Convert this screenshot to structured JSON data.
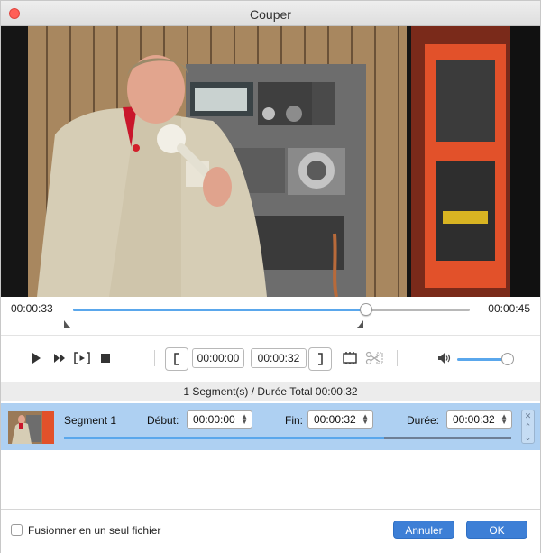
{
  "window": {
    "title": "Couper"
  },
  "timeline": {
    "current_time": "00:00:33",
    "total_time": "00:00:45",
    "progress_fraction": 0.738
  },
  "controls": {
    "start_time": "00:00:00",
    "end_time": "00:00:32",
    "volume_fraction": 0.9,
    "icons": [
      "play-icon",
      "fast-forward-icon",
      "play-selection-icon",
      "stop-icon",
      "set-start-bracket-icon",
      "set-end-bracket-icon",
      "add-segment-icon",
      "split-icon",
      "volume-icon"
    ]
  },
  "summary": {
    "text": "1 Segment(s) / Durée Total 00:00:32"
  },
  "segments": [
    {
      "name": "Segment 1",
      "start_label": "Début:",
      "start_value": "00:00:00",
      "end_label": "Fin:",
      "end_value": "00:00:32",
      "duration_label": "Durée:",
      "duration_value": "00:00:32",
      "progress_fraction": 0.715
    }
  ],
  "footer": {
    "merge_label": "Fusionner en un seul fichier",
    "merge_checked": false,
    "cancel_label": "Annuler",
    "ok_label": "OK"
  },
  "colors": {
    "accent": "#5aa7ec",
    "selection": "#aed0f2",
    "button": "#3d7fd6",
    "close": "#ff5f57"
  }
}
